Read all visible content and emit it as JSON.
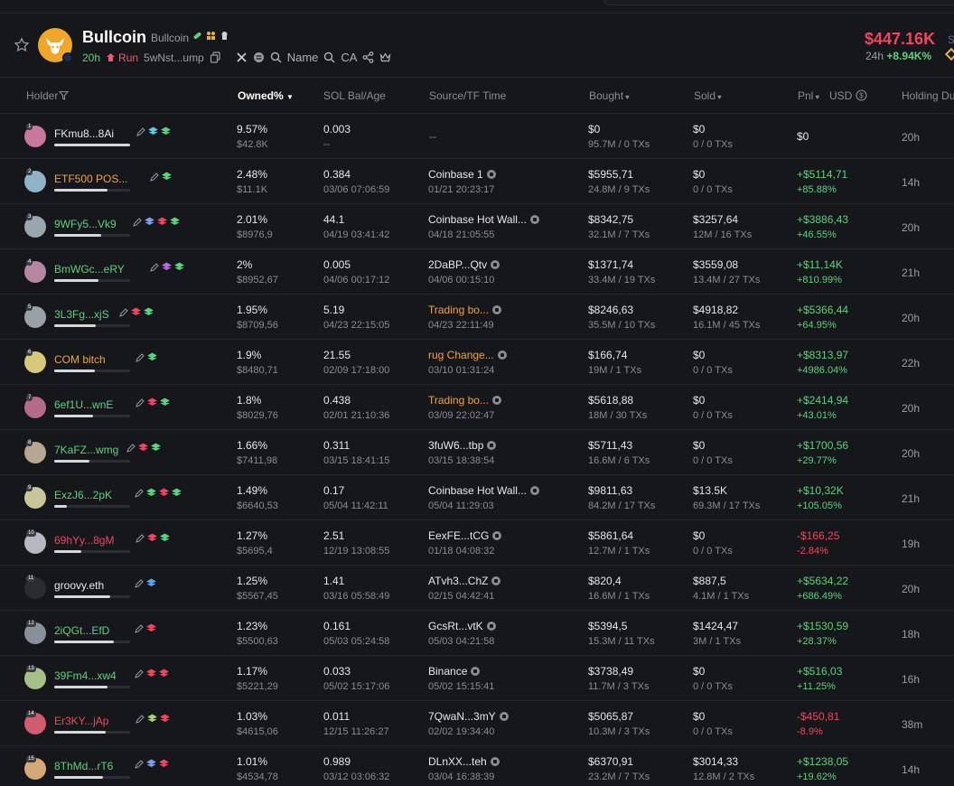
{
  "token": {
    "name": "Bullcoin",
    "symbol": "Bullcoin",
    "age": "20h",
    "run_label": "Run",
    "contract": "5wNst...ump",
    "search_name_label": "Name",
    "search_ca_label": "CA",
    "price": "$447.16K",
    "change_period": "24h",
    "change_value": "+8.94K%",
    "edge_letter": "S"
  },
  "colors": {
    "positive": "#5ed17e",
    "negative": "#f0465f",
    "highlight": "#f2a33a",
    "background": "#16171b"
  },
  "table": {
    "headers": {
      "holder": "Holder",
      "owned": "Owned%",
      "sol": "SOL Bal/Age",
      "source": "Source/TF Time",
      "bought": "Bought",
      "sold": "Sold",
      "pnl": "Pnl",
      "usd": "USD",
      "holding": "Holding Du"
    },
    "rows": [
      {
        "rank": "1",
        "name": "FKmu8...8Ai",
        "owned_pct": "9.57%",
        "owned_usd": "$42.8K",
        "sol": "0.003",
        "sol_age": "--",
        "source": "--",
        "source_time": "",
        "bought": "$0",
        "bought_sub": "95.7M / 0 TXs",
        "sold": "$0",
        "sold_sub": "0 / 0 TXs",
        "pnl": "$0",
        "pnl_pct": "",
        "hold": "20h"
      },
      {
        "rank": "2",
        "name": "ETF500 POS...",
        "owned_pct": "2.48%",
        "owned_usd": "$11.1K",
        "sol": "0.384",
        "sol_age": "03/06 07:06:59",
        "source": "Coinbase 1",
        "source_time": "01/21 20:23:17",
        "bought": "$5955,71",
        "bought_sub": "24.8M / 9 TXs",
        "sold": "$0",
        "sold_sub": "0 / 0 TXs",
        "pnl": "+$5114,71",
        "pnl_pct": "+85.88%",
        "hold": "14h"
      },
      {
        "rank": "3",
        "name": "9WFy5...Vk9",
        "owned_pct": "2.01%",
        "owned_usd": "$8976,9",
        "sol": "44.1",
        "sol_age": "04/19 03:41:42",
        "source": "Coinbase Hot Wall...",
        "source_time": "04/18 21:05:55",
        "bought": "$8342,75",
        "bought_sub": "32.1M / 7 TXs",
        "sold": "$3257,64",
        "sold_sub": "12M / 16 TXs",
        "pnl": "+$3886,43",
        "pnl_pct": "+46.55%",
        "hold": "20h"
      },
      {
        "rank": "4",
        "name": "BmWGc...eRY",
        "owned_pct": "2%",
        "owned_usd": "$8952,67",
        "sol": "0.005",
        "sol_age": "04/06 00:17:12",
        "source": "2DaBP...Qtv",
        "source_time": "04/06 00:15:10",
        "bought": "$1371,74",
        "bought_sub": "33.4M / 19 TXs",
        "sold": "$3559,08",
        "sold_sub": "13.4M / 27 TXs",
        "pnl": "+$11,14K",
        "pnl_pct": "+810.99%",
        "hold": "21h"
      },
      {
        "rank": "5",
        "name": "3L3Fg...xjS",
        "owned_pct": "1.95%",
        "owned_usd": "$8709,56",
        "sol": "5.19",
        "sol_age": "04/23 22:15:05",
        "source": "Trading bo...",
        "source_time": "04/23 22:11:49",
        "bought": "$8246,63",
        "bought_sub": "35.5M / 10 TXs",
        "sold": "$4918,82",
        "sold_sub": "16.1M / 45 TXs",
        "pnl": "+$5366,44",
        "pnl_pct": "+64.95%",
        "hold": "20h"
      },
      {
        "rank": "6",
        "name": "COM bitch",
        "owned_pct": "1.9%",
        "owned_usd": "$8480,71",
        "sol": "21.55",
        "sol_age": "02/09 17:18:00",
        "source": "rug Change...",
        "source_time": "03/10 01:31:24",
        "bought": "$166,74",
        "bought_sub": "19M / 1 TXs",
        "sold": "$0",
        "sold_sub": "0 / 0 TXs",
        "pnl": "+$8313,97",
        "pnl_pct": "+4986.04%",
        "hold": "22h"
      },
      {
        "rank": "7",
        "name": "6ef1U...wnE",
        "owned_pct": "1.8%",
        "owned_usd": "$8029,76",
        "sol": "0.438",
        "sol_age": "02/01 21:10:36",
        "source": "Trading bo...",
        "source_time": "03/09 22:02:47",
        "bought": "$5618,88",
        "bought_sub": "18M / 30 TXs",
        "sold": "$0",
        "sold_sub": "0 / 0 TXs",
        "pnl": "+$2414,94",
        "pnl_pct": "+43.01%",
        "hold": "20h"
      },
      {
        "rank": "8",
        "name": "7KaFZ...wmg",
        "owned_pct": "1.66%",
        "owned_usd": "$7411,98",
        "sol": "0.311",
        "sol_age": "03/15 18:41:15",
        "source": "3fuW6...tbp",
        "source_time": "03/15 18:38:54",
        "bought": "$5711,43",
        "bought_sub": "16.6M / 6 TXs",
        "sold": "$0",
        "sold_sub": "0 / 0 TXs",
        "pnl": "+$1700,56",
        "pnl_pct": "+29.77%",
        "hold": "20h"
      },
      {
        "rank": "9",
        "name": "ExzJ6...2pK",
        "owned_pct": "1.49%",
        "owned_usd": "$6640,53",
        "sol": "0.17",
        "sol_age": "05/04 11:42:11",
        "source": "Coinbase Hot Wall...",
        "source_time": "05/04 11:29:03",
        "bought": "$9811,63",
        "bought_sub": "84.2M / 17 TXs",
        "sold": "$13.5K",
        "sold_sub": "69.3M / 17 TXs",
        "pnl": "+$10,32K",
        "pnl_pct": "+105.05%",
        "hold": "21h"
      },
      {
        "rank": "10",
        "name": "69hYy...8gM",
        "owned_pct": "1.27%",
        "owned_usd": "$5695,4",
        "sol": "2.51",
        "sol_age": "12/19 13:08:55",
        "source": "EexFE...tCG",
        "source_time": "01/18 04:08:32",
        "bought": "$5861,64",
        "bought_sub": "12.7M / 1 TXs",
        "sold": "$0",
        "sold_sub": "0 / 0 TXs",
        "pnl": "-$166,25",
        "pnl_pct": "-2.84%",
        "hold": "19h"
      },
      {
        "rank": "11",
        "name": "groovy.eth",
        "owned_pct": "1.25%",
        "owned_usd": "$5567,45",
        "sol": "1.41",
        "sol_age": "03/16 05:58:49",
        "source": "ATvh3...ChZ",
        "source_time": "02/15 04:42:41",
        "bought": "$820,4",
        "bought_sub": "16.6M / 1 TXs",
        "sold": "$887,5",
        "sold_sub": "4.1M / 1 TXs",
        "pnl": "+$5634,22",
        "pnl_pct": "+686.49%",
        "hold": "20h"
      },
      {
        "rank": "12",
        "name": "2iQGt...EfD",
        "owned_pct": "1.23%",
        "owned_usd": "$5500,63",
        "sol": "0.161",
        "sol_age": "05/03 05:24:58",
        "source": "GcsRt...vtK",
        "source_time": "05/03 04:21:58",
        "bought": "$5394,5",
        "bought_sub": "15.3M / 11 TXs",
        "sold": "$1424,47",
        "sold_sub": "3M / 1 TXs",
        "pnl": "+$1530,59",
        "pnl_pct": "+28.37%",
        "hold": "18h"
      },
      {
        "rank": "13",
        "name": "39Fm4...xw4",
        "owned_pct": "1.17%",
        "owned_usd": "$5221,29",
        "sol": "0.033",
        "sol_age": "05/02 15:17:06",
        "source": "Binance",
        "source_time": "05/02 15:15:41",
        "bought": "$3738,49",
        "bought_sub": "11.7M / 3 TXs",
        "sold": "$0",
        "sold_sub": "0 / 0 TXs",
        "pnl": "+$516,03",
        "pnl_pct": "+11.25%",
        "hold": "16h"
      },
      {
        "rank": "14",
        "name": "Er3KY...jAp",
        "owned_pct": "1.03%",
        "owned_usd": "$4615,06",
        "sol": "0.011",
        "sol_age": "12/15 11:26:27",
        "source": "7QwaN...3mY",
        "source_time": "02/02 19:34:40",
        "bought": "$5065,87",
        "bought_sub": "10.3M / 3 TXs",
        "sold": "$0",
        "sold_sub": "0 / 0 TXs",
        "pnl": "-$450,81",
        "pnl_pct": "-8.9%",
        "hold": "38m"
      },
      {
        "rank": "15",
        "name": "8ThMd...rT6",
        "owned_pct": "1.01%",
        "owned_usd": "$4534,78",
        "sol": "0.989",
        "sol_age": "03/12 03:06:32",
        "source": "DLnXX...teh",
        "source_time": "03/04 16:38:39",
        "bought": "$6370,91",
        "bought_sub": "23.2M / 7 TXs",
        "sold": "$3014,33",
        "sold_sub": "12.8M / 2 TXs",
        "pnl": "+$1238,05",
        "pnl_pct": "+19.62%",
        "hold": "14h"
      }
    ]
  }
}
